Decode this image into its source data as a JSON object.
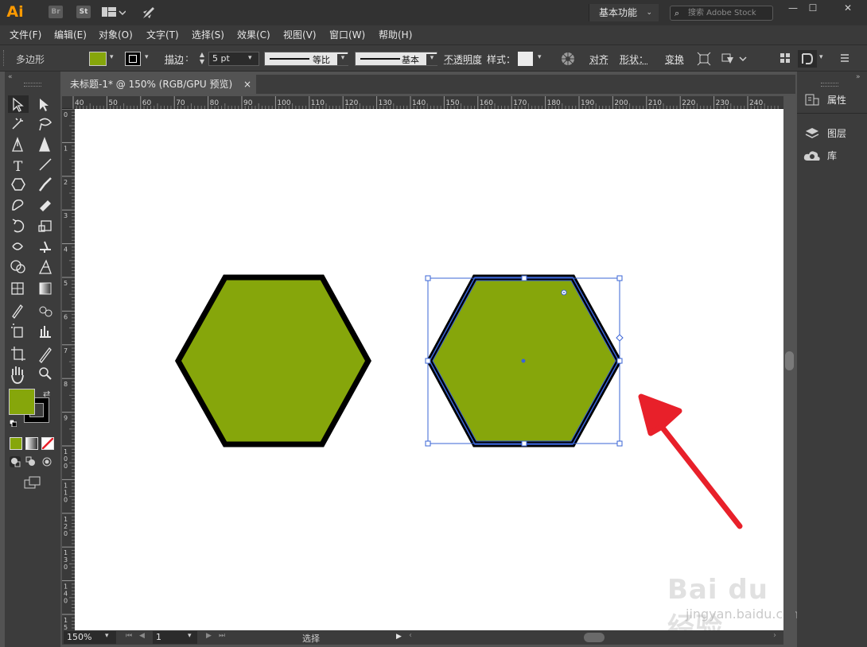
{
  "titlebar": {
    "app_logo": "Ai",
    "bridge_label": "Br",
    "stock_label": "St",
    "workspace": "基本功能",
    "search_placeholder": "搜索 Adobe Stock",
    "minimize": "—",
    "maximize": "☐",
    "close": "✕"
  },
  "menu": [
    "文件(F)",
    "编辑(E)",
    "对象(O)",
    "文字(T)",
    "选择(S)",
    "效果(C)",
    "视图(V)",
    "窗口(W)",
    "帮助(H)"
  ],
  "control_bar": {
    "selection_type": "多边形",
    "stroke_label": "描边",
    "stroke_colon": ":",
    "stroke_weight": "5 pt",
    "stroke_profile": "等比",
    "brush": "基本",
    "opacity_label": "不透明度",
    "style_label": "样式：",
    "align_label": "对齐",
    "shape_label": "形状：",
    "transform_label": "变换",
    "fill_color": "#86a60b",
    "stroke_color": "#000000"
  },
  "document": {
    "tab_title": "未标题-1* @ 150% (RGB/GPU 预览)",
    "tab_close": "×"
  },
  "ruler": {
    "h_ticks": [
      "40",
      "50",
      "60",
      "70",
      "80",
      "90",
      "100",
      "110",
      "120",
      "130",
      "140",
      "150",
      "160",
      "170",
      "180",
      "190",
      "200",
      "210",
      "220",
      "230",
      "240"
    ],
    "v_ticks": [
      "0",
      "1",
      "2",
      "3",
      "4",
      "5",
      "6",
      "7",
      "8",
      "9",
      "100",
      "110",
      "120",
      "130",
      "140",
      "150"
    ]
  },
  "right_panel": {
    "properties": "属性",
    "layers": "图层",
    "libraries": "库"
  },
  "status": {
    "zoom": "150%",
    "artboard_number": "1",
    "tool_state": "选择"
  },
  "canvas": {
    "hex_fill": "#86a60b",
    "selection_color": "#3a64d6",
    "arrow_color": "#e8202a"
  },
  "watermark": {
    "brand": "Bai du 经验",
    "url": "jingyan.baidu.com"
  }
}
